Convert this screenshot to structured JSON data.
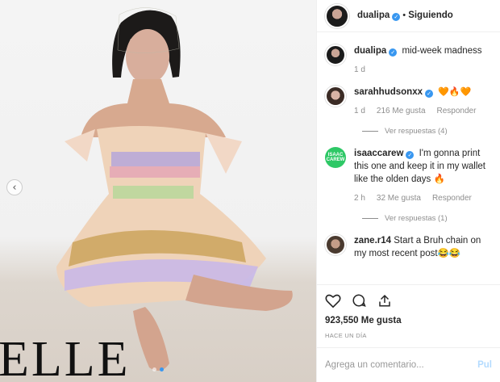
{
  "post": {
    "brand_text": "ELLE",
    "carousel_prev_icon": "chevron-left-icon",
    "carousel_dots": 2,
    "active_dot": 1
  },
  "header": {
    "username": "dualipa",
    "separator": "•",
    "follow_label": "Siguiendo"
  },
  "caption": {
    "username": "dualipa",
    "text": "mid-week madness",
    "time": "1 d"
  },
  "comments": [
    {
      "username": "sarahhudsonxx",
      "text": "🧡🔥🧡",
      "time": "1 d",
      "likes": "216 Me gusta",
      "reply": "Responder",
      "view_replies": "Ver respuestas (4)"
    },
    {
      "username": "isaaccarew",
      "avatar_text": "ISAAC CAREW",
      "text": "I'm gonna print this one and keep it in my wallet like the olden days 🔥",
      "time": "2 h",
      "likes": "32 Me gusta",
      "reply": "Responder",
      "view_replies": "Ver respuestas (1)"
    },
    {
      "username": "zane.r14",
      "text": "Start a Bruh chain on my most recent post😂😂"
    }
  ],
  "actions": {
    "likes": "923,550 Me gusta",
    "time_ago": "HACE UN DÍA"
  },
  "add_comment": {
    "placeholder": "Agrega un comentario...",
    "post_label": "Pul"
  },
  "colors": {
    "verified": "#3897f0",
    "link_blue": "#3897f0",
    "muted": "#8e8e8e"
  }
}
